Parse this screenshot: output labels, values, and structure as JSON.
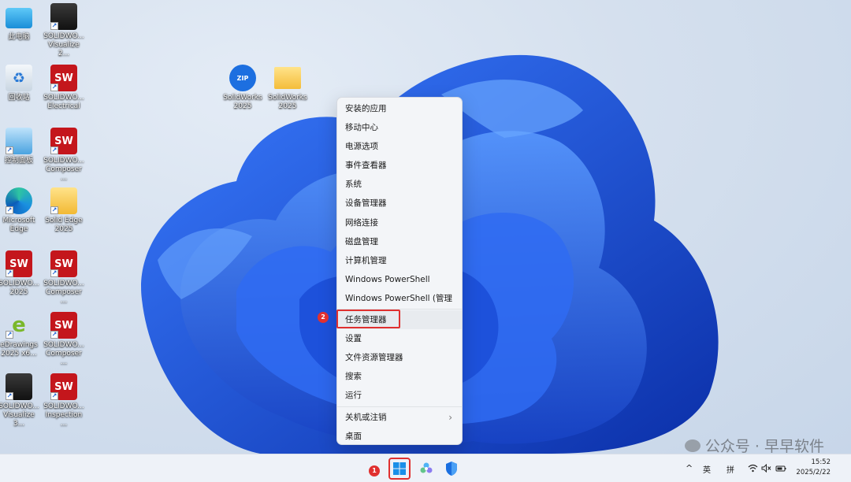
{
  "desktop": {
    "icons": [
      {
        "label": "此电脑"
      },
      {
        "label": "SOLIDWO...\nVisualize 2..."
      },
      {
        "label": "回收站"
      },
      {
        "label": "SOLIDWO...\nElectrical"
      },
      {
        "label": "控制面板"
      },
      {
        "label": "SOLIDWO...\nComposer ..."
      },
      {
        "label": "Microsoft\nEdge"
      },
      {
        "label": "Solid Edge\n2025"
      },
      {
        "label": "SOLIDWO...\n2025"
      },
      {
        "label": "SOLIDWO...\nComposer ..."
      },
      {
        "label": "eDrawings\n2025 x6..."
      },
      {
        "label": "SOLIDWO...\nComposer ..."
      },
      {
        "label": "SOLIDWO...\nVisualize 3..."
      },
      {
        "label": "SOLIDWO...\nInspection ..."
      },
      {
        "label": "SolidWorks\n2025"
      },
      {
        "label": "SolidWorks\n2025"
      }
    ],
    "icon_text": {
      "sw": "SW",
      "year": "2025",
      "zip": "ZIP",
      "e": "e"
    }
  },
  "context_menu": {
    "items": [
      "安装的应用",
      "移动中心",
      "电源选项",
      "事件查看器",
      "系统",
      "设备管理器",
      "网络连接",
      "磁盘管理",
      "计算机管理",
      "Windows PowerShell",
      "Windows PowerShell (管理员)",
      "任务管理器",
      "设置",
      "文件资源管理器",
      "搜索",
      "运行",
      "关机或注销",
      "桌面"
    ],
    "submenu_arrow": "›"
  },
  "annotations": {
    "step1": "1",
    "step2": "2"
  },
  "taskbar": {
    "tray": {
      "chevron": "^",
      "lang1": "英",
      "lang2": "拼",
      "time": "15:52",
      "date": "2025/2/22"
    }
  },
  "watermark": {
    "text": "公众号 · 早早软件"
  },
  "colors": {
    "accent": "#1a5fd0",
    "highlight": "#e0302f"
  }
}
